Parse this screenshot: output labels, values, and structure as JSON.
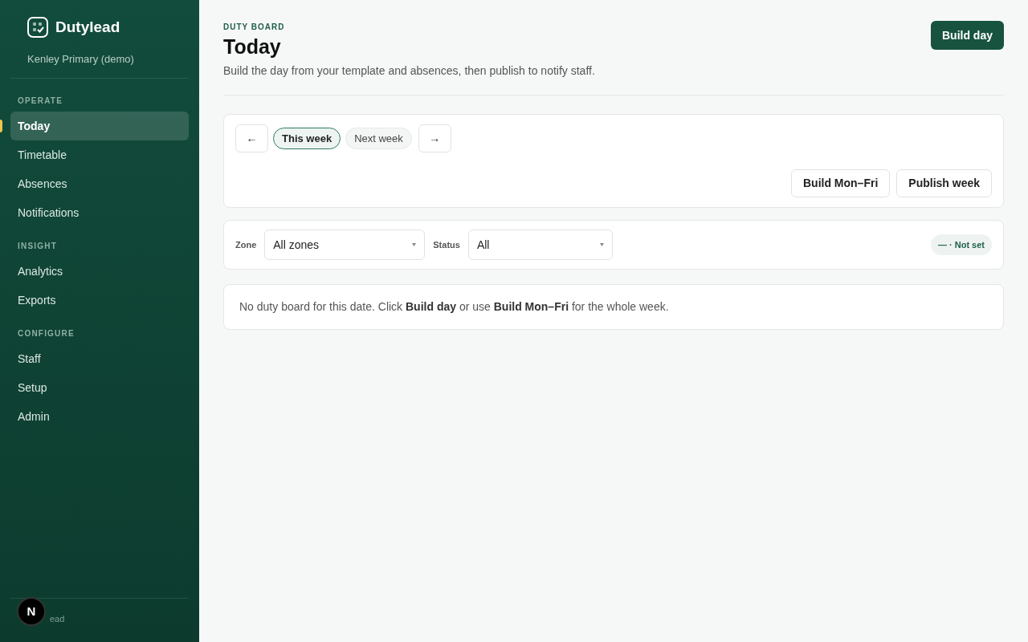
{
  "sidebar": {
    "brand": "Dutylead",
    "org": "Kenley Primary (demo)",
    "sections": [
      {
        "heading": "OPERATE",
        "items": [
          {
            "label": "Today",
            "selected": true
          },
          {
            "label": "Timetable",
            "selected": false
          },
          {
            "label": "Absences",
            "selected": false
          },
          {
            "label": "Notifications",
            "selected": false
          }
        ]
      },
      {
        "heading": "INSIGHT",
        "items": [
          {
            "label": "Analytics",
            "selected": false
          },
          {
            "label": "Exports",
            "selected": false
          }
        ]
      },
      {
        "heading": "CONFIGURE",
        "items": [
          {
            "label": "Staff",
            "selected": false
          },
          {
            "label": "Setup",
            "selected": false
          },
          {
            "label": "Admin",
            "selected": false
          }
        ]
      }
    ],
    "footer": "ead",
    "dev_badge": "N"
  },
  "header": {
    "eyebrow": "DUTY BOARD",
    "title": "Today",
    "subtitle": "Build the day from your template and absences, then publish to notify staff.",
    "action": "Build day"
  },
  "week_nav": {
    "prev": "←",
    "next": "→",
    "weeks": [
      {
        "label": "This week",
        "selected": true
      },
      {
        "label": "Next week",
        "selected": false
      }
    ],
    "actions": [
      "Build Mon–Fri",
      "Publish week"
    ]
  },
  "filters": [
    {
      "label": "Zone",
      "value": "All zones"
    },
    {
      "label": "Status",
      "value": "All"
    }
  ],
  "status_pill": "— · Not set",
  "empty_message": "No duty board for this date. Click **Build day** or use **Build Mon–Fri** for the whole week."
}
